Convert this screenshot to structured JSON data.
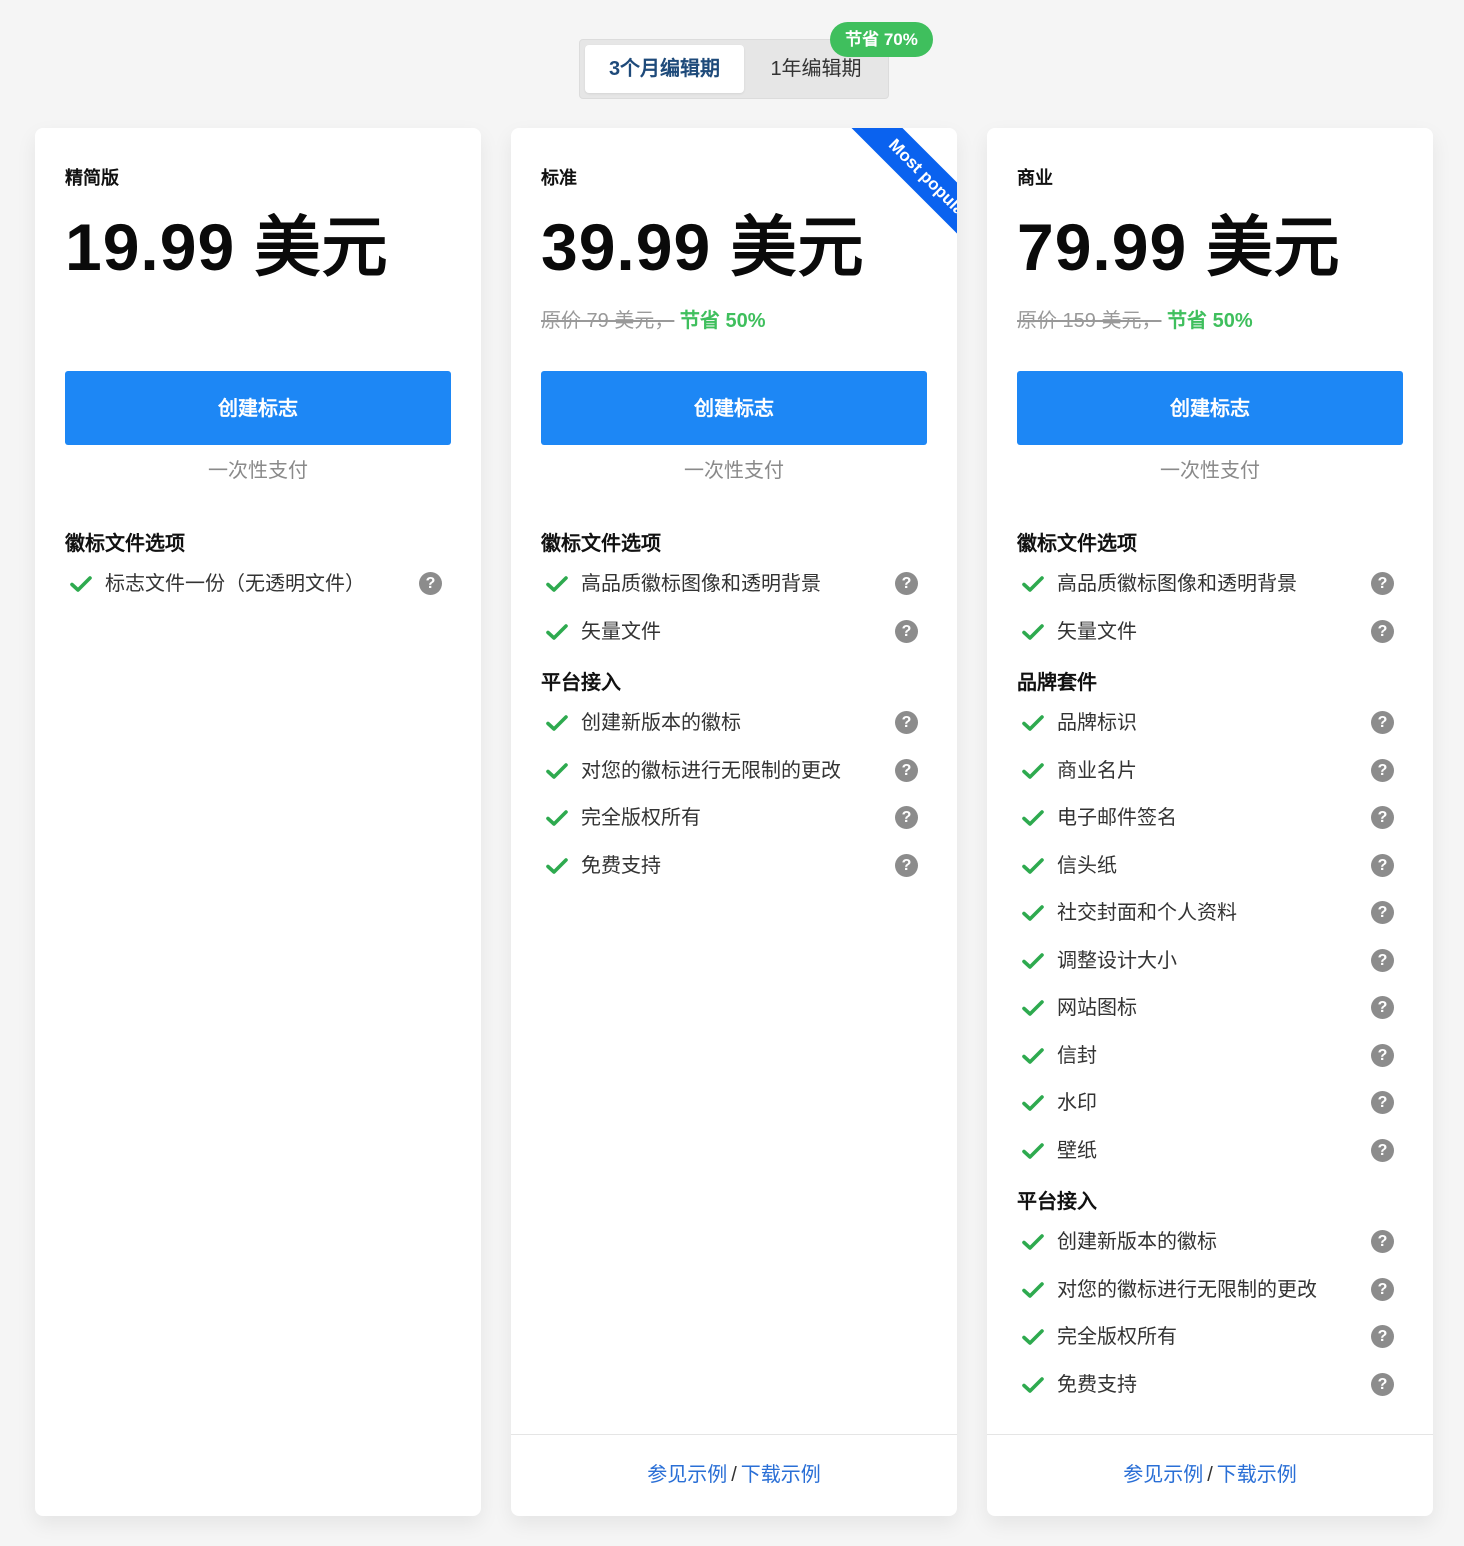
{
  "billing_toggle": {
    "options": [
      "3个月编辑期",
      "1年编辑期"
    ],
    "selected": "3个月编辑期",
    "badge": "节省 70%"
  },
  "plans": [
    {
      "name": "精简版",
      "price": "19.99 美元",
      "cta": "创建标志",
      "payment_note": "一次性支付",
      "sections": [
        {
          "title": "徽标文件选项",
          "items": [
            "标志文件一份（无透明文件）"
          ]
        }
      ]
    },
    {
      "name": "标准",
      "ribbon": "Most popular",
      "price": "39.99 美元",
      "original_price": "原价 79 美元，",
      "savings": "节省 50%",
      "cta": "创建标志",
      "payment_note": "一次性支付",
      "sections": [
        {
          "title": "徽标文件选项",
          "items": [
            "高品质徽标图像和透明背景",
            "矢量文件"
          ]
        },
        {
          "title": "平台接入",
          "items": [
            "创建新版本的徽标",
            "对您的徽标进行无限制的更改",
            "完全版权所有",
            "免费支持"
          ]
        }
      ],
      "footer": {
        "link1": "参见示例",
        "separator": "/",
        "link2": "下载示例"
      }
    },
    {
      "name": "商业",
      "price": "79.99 美元",
      "original_price": "原价 159 美元，",
      "savings": "节省 50%",
      "cta": "创建标志",
      "payment_note": "一次性支付",
      "sections": [
        {
          "title": "徽标文件选项",
          "items": [
            "高品质徽标图像和透明背景",
            "矢量文件"
          ]
        },
        {
          "title": "品牌套件",
          "items": [
            "品牌标识",
            "商业名片",
            "电子邮件签名",
            "信头纸",
            "社交封面和个人资料",
            "调整设计大小",
            "网站图标",
            "信封",
            "水印",
            "壁纸"
          ]
        },
        {
          "title": "平台接入",
          "items": [
            "创建新版本的徽标",
            "对您的徽标进行无限制的更改",
            "完全版权所有",
            "免费支持"
          ]
        }
      ],
      "footer": {
        "link1": "参见示例",
        "separator": "/",
        "link2": "下载示例"
      }
    }
  ],
  "icons": {
    "check": "check-icon",
    "help": "question-circle-icon"
  },
  "colors": {
    "primary": "#1d87f5",
    "success": "#3fbf5d",
    "ribbon": "#0a62ef",
    "link": "#2a6fd6"
  }
}
